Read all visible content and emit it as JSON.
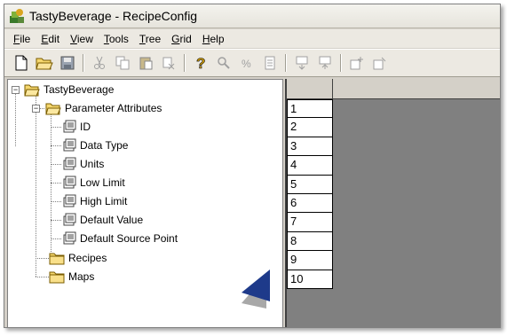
{
  "window": {
    "title": "TastyBeverage - RecipeConfig"
  },
  "menu": [
    {
      "first": "F",
      "rest": "ile"
    },
    {
      "first": "E",
      "rest": "dit"
    },
    {
      "first": "V",
      "rest": "iew"
    },
    {
      "first": "T",
      "rest": "ools"
    },
    {
      "first": "T",
      "rest": "ree",
      "pre": ""
    },
    {
      "first": "G",
      "rest": "rid"
    },
    {
      "first": "H",
      "rest": "elp"
    }
  ],
  "tree": {
    "root": "TastyBeverage",
    "parameter_attributes": "Parameter Attributes",
    "attributes": [
      "ID",
      "Data Type",
      "Units",
      "Low Limit",
      "High Limit",
      "Default Value",
      "Default Source Point"
    ],
    "recipes": "Recipes",
    "maps": "Maps"
  },
  "grid": {
    "header_row": "1",
    "rows": [
      "2",
      "3",
      "4",
      "5",
      "6",
      "7",
      "8",
      "9",
      "10"
    ]
  },
  "colors": {
    "window_bg": "#d4d0c8",
    "grid_bg": "#808080",
    "folder": "#f5d76e",
    "arrow": "#1e3a8a"
  }
}
